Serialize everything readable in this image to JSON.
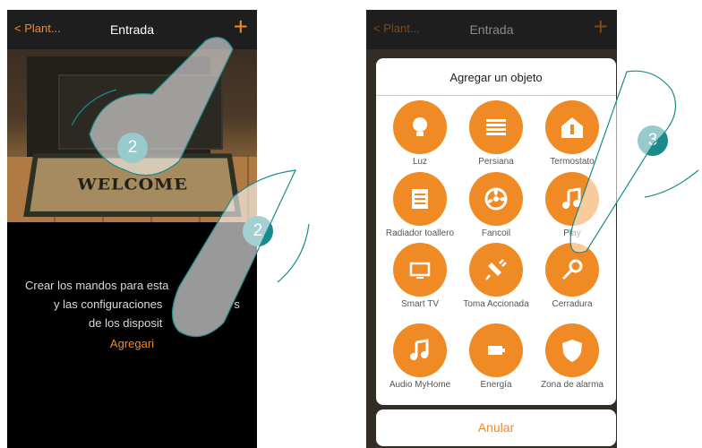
{
  "left_screen": {
    "back_label": "Plant...",
    "title": "Entrada",
    "plus_label": "+",
    "mat_text": "WELCOME",
    "description_line1": "Crear los mandos para esta",
    "description_line2": "y las configuraciones",
    "description_line2_right": "s",
    "description_line3": "de los disposit",
    "add_link": "Agregari"
  },
  "right_screen": {
    "back_label": "Plant...",
    "title": "Entrada",
    "plus_label": "+",
    "modal_title": "Agregar un objeto",
    "cancel_label": "Anular",
    "items": [
      {
        "label": "Luz",
        "icon": "bulb-icon"
      },
      {
        "label": "Persiana",
        "icon": "shutter-icon"
      },
      {
        "label": "Termostato",
        "icon": "thermostat-icon"
      },
      {
        "label": "Radiador toallero",
        "icon": "towel-radiator-icon"
      },
      {
        "label": "Fancoil",
        "icon": "fan-icon"
      },
      {
        "label": "Play",
        "icon": "music-note-icon"
      },
      {
        "label": "Smart TV",
        "icon": "tv-icon"
      },
      {
        "label": "Toma Accionada",
        "icon": "plug-icon"
      },
      {
        "label": "Cerradura",
        "icon": "key-icon"
      },
      {
        "label": "Audio MyHome",
        "icon": "music-note-icon"
      },
      {
        "label": "Energía",
        "icon": "battery-icon"
      },
      {
        "label": "Zona de alarma",
        "icon": "shield-icon"
      }
    ]
  },
  "badges": [
    "2",
    "2",
    "3"
  ],
  "colors": {
    "accent": "#f08a24",
    "badge": "#1a8a8c",
    "topbar": "#1e1e1e"
  }
}
